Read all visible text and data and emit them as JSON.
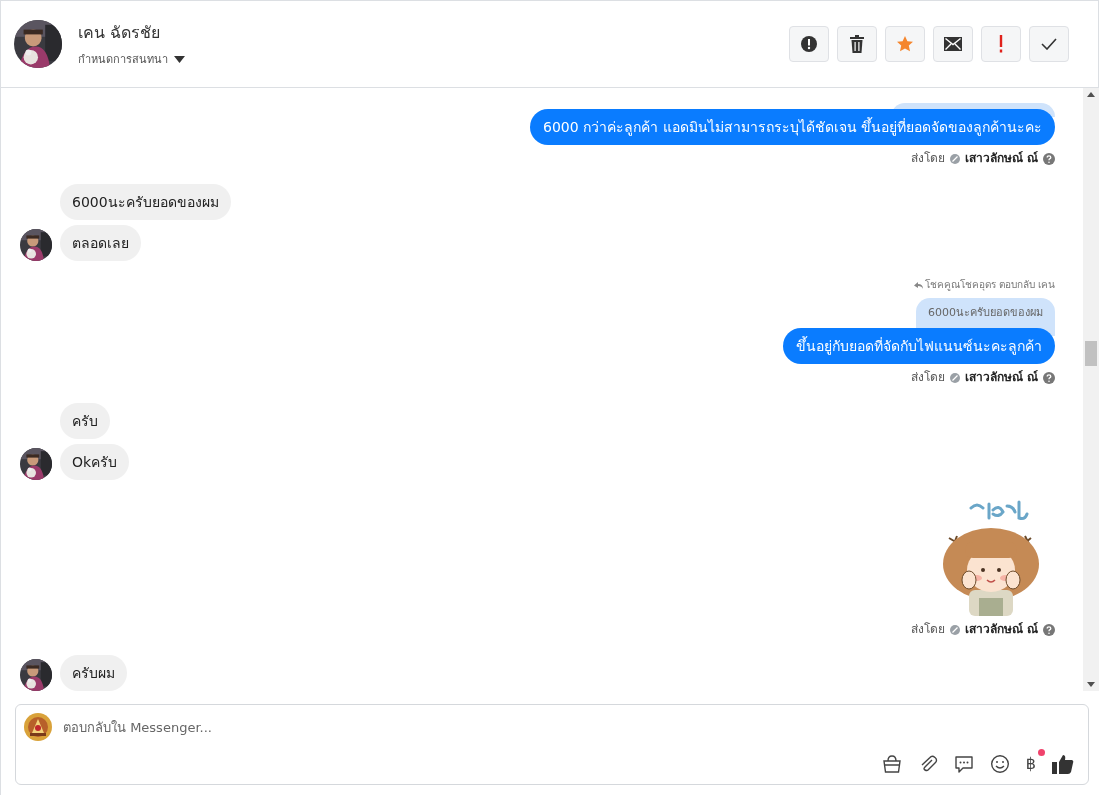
{
  "header": {
    "name": "เคน ฉัดรชัย",
    "subtitle": "กำหนดการสนทนา"
  },
  "actions": [
    {
      "kind": "alert"
    },
    {
      "kind": "trash"
    },
    {
      "kind": "star"
    },
    {
      "kind": "mail"
    },
    {
      "kind": "important"
    },
    {
      "kind": "done"
    }
  ],
  "messages": [
    {
      "kind": "outgoing",
      "hidden_quote": true,
      "text": "6000 กว่าค่ะลูกค้า แอดมินไม่สามารถระบุได้ชัดเจน ขึ้นอยู่ที่ยอดจัดของลูกค้านะคะ",
      "sent_label": "ส่งโดย",
      "sender": "เสาวลักษณ์ ณ์"
    },
    {
      "kind": "incoming",
      "texts": [
        "6000นะครับยอดของผม",
        "ตลอดเลย"
      ]
    },
    {
      "kind": "outgoing",
      "reply_label": "โชคคูณโชคอุดร ตอบกลับ เคน",
      "quote": "6000นะครับยอดของผม",
      "text": "ขึ้นอยู่กับยอดที่จัดกับไฟแนนซ์นะคะลูกค้า",
      "sent_label": "ส่งโดย",
      "sender": "เสาวลักษณ์ ณ์"
    },
    {
      "kind": "incoming",
      "texts": [
        "ครับ",
        "Okครับ"
      ]
    },
    {
      "kind": "sticker",
      "sent_label": "ส่งโดย",
      "sender": "เสาวลักษณ์ ณ์"
    },
    {
      "kind": "incoming",
      "texts": [
        "ครับผม"
      ]
    }
  ],
  "composer": {
    "placeholder": "ตอบกลับใน Messenger...",
    "tools": [
      {
        "kind": "shop"
      },
      {
        "kind": "attach"
      },
      {
        "kind": "chat"
      },
      {
        "kind": "emoji"
      },
      {
        "kind": "payment",
        "label": "฿",
        "badge": true
      },
      {
        "kind": "like"
      }
    ]
  }
}
